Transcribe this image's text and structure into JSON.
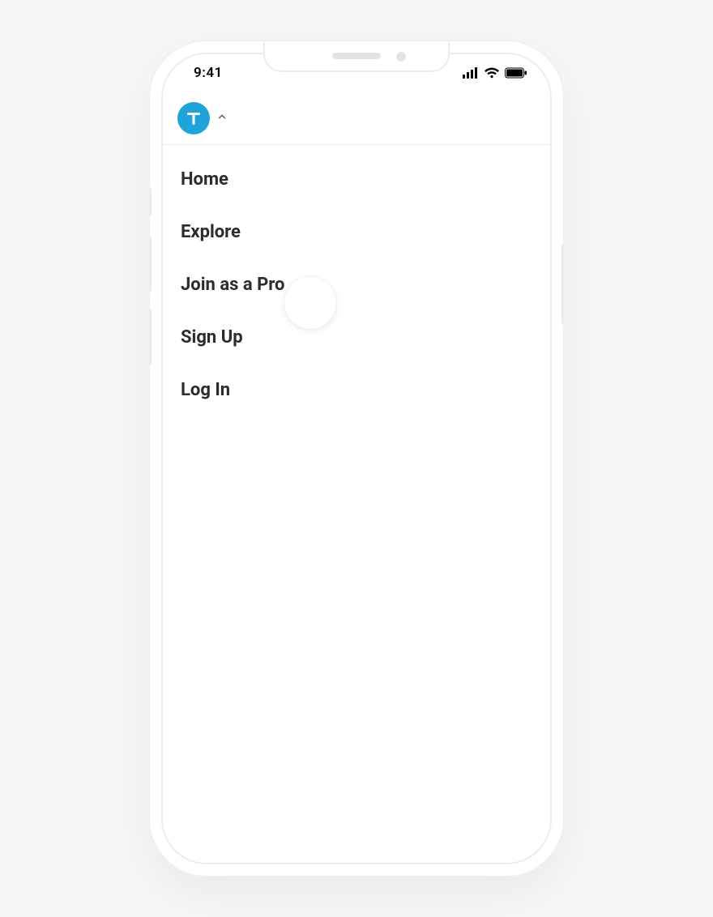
{
  "status": {
    "time": "9:41"
  },
  "header": {
    "logo_letter": "T"
  },
  "menu": {
    "items": [
      {
        "label": "Home"
      },
      {
        "label": "Explore"
      },
      {
        "label": "Join as a Pro"
      },
      {
        "label": "Sign Up"
      },
      {
        "label": "Log In"
      }
    ]
  },
  "colors": {
    "brand": "#1ea4d9",
    "text": "#2c2c2c",
    "divider": "#ebebeb",
    "background": "#f7f7f7"
  }
}
